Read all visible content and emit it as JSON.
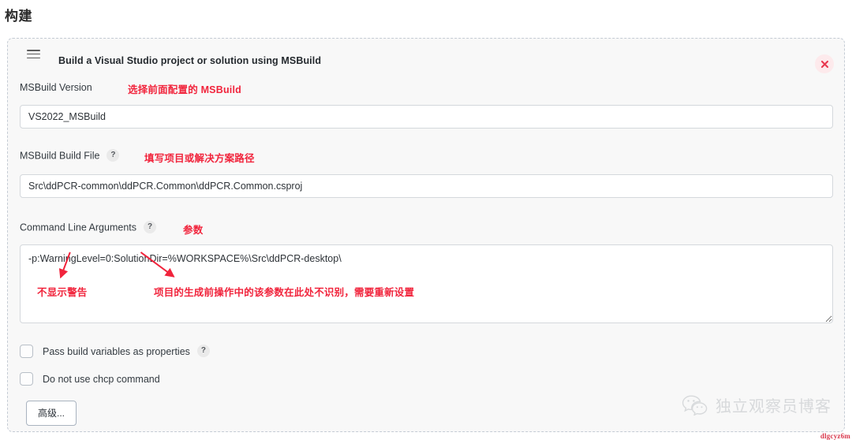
{
  "page": {
    "title": "构建"
  },
  "panel": {
    "header_title": "Build a Visual Studio project or solution using MSBuild",
    "menu_icon": "hamburger-icon",
    "close_icon": "close-icon",
    "close_color": "#e8384f"
  },
  "fields": {
    "msbuild_version": {
      "label": "MSBuild Version",
      "value": "VS2022_MSBuild",
      "options": [
        "VS2022_MSBuild"
      ],
      "annotation": "选择前面配置的 MSBuild"
    },
    "build_file": {
      "label": "MSBuild Build File",
      "help": "?",
      "value": "Src\\ddPCR-common\\ddPCR.Common\\ddPCR.Common.csproj",
      "placeholder": "",
      "annotation": "填写项目或解决方案路径"
    },
    "command_line_arguments": {
      "label": "Command Line Arguments",
      "help": "?",
      "value": "-p:WarningLevel=0:SolutionDir=%WORKSPACE%\\Src\\ddPCR-desktop\\",
      "placeholder": "",
      "annotation": "参数",
      "inner_annotation_1": "不显示警告",
      "inner_annotation_2": "项目的生成前操作中的该参数在此处不识别，需要重新设置"
    }
  },
  "checkboxes": [
    {
      "label": "Pass build variables as properties",
      "checked": false,
      "help": "?"
    },
    {
      "label": "Do not use chcp command",
      "checked": false,
      "help": ""
    }
  ],
  "buttons": {
    "advanced": "高级..."
  },
  "watermark": {
    "icon": "wechat-icon",
    "text": "独立观察员博客",
    "tag": "dlgcyz6m"
  },
  "colors": {
    "annotation_red": "#f1243c",
    "panel_bg": "#f8f8f8",
    "panel_border": "#c4cbd4"
  }
}
